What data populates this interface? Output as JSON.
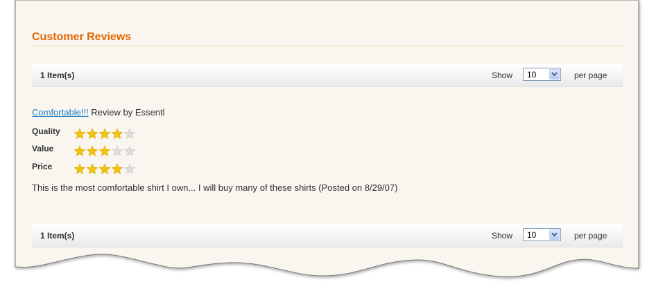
{
  "colors": {
    "title": "#e26703",
    "link": "#1e7ec8",
    "star_filled": "#f1c40f",
    "star_empty": "#dcdcdc",
    "panel_bg": "#f8f6ef",
    "text": "#2f2f2f"
  },
  "section": {
    "title": "Customer Reviews"
  },
  "toolbar_top": {
    "item_count": "1 Item(s)",
    "show_label": "Show",
    "per_page_value": "10",
    "per_page_label": "per page"
  },
  "toolbar_bottom": {
    "item_count": "1 Item(s)",
    "show_label": "Show",
    "per_page_value": "10",
    "per_page_label": "per page"
  },
  "review": {
    "title": "Comfortable!!!",
    "byline": " Review by Essentl",
    "ratings": [
      {
        "label": "Quality",
        "stars": 4,
        "max": 5
      },
      {
        "label": "Value",
        "stars": 3,
        "max": 5
      },
      {
        "label": "Price",
        "stars": 4,
        "max": 5
      }
    ],
    "body": "This is the most comfortable shirt I own... I will buy many of these shirts (Posted on 8/29/07)"
  }
}
